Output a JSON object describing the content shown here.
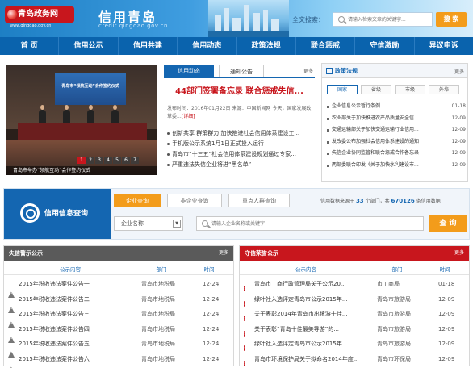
{
  "header": {
    "logo_text": "青岛政务网",
    "logo_sub": "www.qingdao.gov.cn",
    "brand_title": "信用青岛",
    "brand_url": "credit.qingdao.gov.cn",
    "search_label": "全文搜索：",
    "search_placeholder": "请输入检索文章的关键字...",
    "search_button": "搜 索"
  },
  "nav": [
    "首 页",
    "信用公示",
    "信用共建",
    "信用动态",
    "政策法规",
    "联合惩戒",
    "守信激励",
    "异议申诉"
  ],
  "slideshow": {
    "screen_text": "青岛市“领航互动”会作签约仪式",
    "pages": [
      "1",
      "2",
      "3",
      "4",
      "5",
      "6",
      "7"
    ],
    "active_page": "1",
    "caption": "青岛市举办“领航互动”会作签约仪式"
  },
  "news": {
    "tab_active": "信用动态",
    "tab_other": "通知公告",
    "more": "更多",
    "headline": "44部门签署备忘录 联合惩戒失信...",
    "meta": "发布时间：2016年01月22日  来源：中国新闻网  今天，国家发展改革委...",
    "detail_link": "[详细]",
    "items": [
      "创新共享 群策群力 加快推进社会信用体系建设工...",
      "手机版公示系统1月1日正式投入运行",
      "青岛市“十三五”社会信用体系建设规划通过专家...",
      "严重违法失信企业将进“黑名单”"
    ]
  },
  "policy": {
    "title": "政策法规",
    "more": "更多",
    "tabs": [
      "国家",
      "省级",
      "市级",
      "外埠"
    ],
    "active_tab": "国家",
    "items": [
      {
        "text": "企业信息公示暂行条例",
        "date": "01-18"
      },
      {
        "text": "农业部关于加快推进农产品质量安全信...",
        "date": "12-09"
      },
      {
        "text": "交通运输部关于加快交通运输行业信用...",
        "date": "12-09"
      },
      {
        "text": "发改委公布加强社会信用体系建设的通知",
        "date": "12-09"
      },
      {
        "text": "失信企业协同监管和联合惩戒合作备忘录",
        "date": "12-09"
      },
      {
        "text": "两部委联合印发《关于加快水利建设市...",
        "date": "12-09"
      }
    ]
  },
  "query": {
    "title": "信用信息查询",
    "tabs": [
      "企业查询",
      "非企业查询",
      "重点人群查询"
    ],
    "active_tab": "企业查询",
    "stat_prefix": "信用数据来源于",
    "stat_depts": "33",
    "stat_middle": "个部门，共",
    "stat_count": "670126",
    "stat_suffix": "条信用数据",
    "select_value": "企业名称",
    "input_placeholder": "请输入企业名称或关键字",
    "button": "查 询"
  },
  "black": {
    "title": "失信警示公示",
    "more": "更多",
    "cols": [
      "公示内容",
      "部门",
      "时间"
    ],
    "rows": [
      {
        "text": "2015年税收违法案件公告一",
        "dept": "青岛市地税局",
        "date": "12-24"
      },
      {
        "text": "2015年税收违法案件公告二",
        "dept": "青岛市地税局",
        "date": "12-24"
      },
      {
        "text": "2015年税收违法案件公告三",
        "dept": "青岛市地税局",
        "date": "12-24"
      },
      {
        "text": "2015年税收违法案件公告四",
        "dept": "青岛市地税局",
        "date": "12-24"
      },
      {
        "text": "2015年税收违法案件公告五",
        "dept": "青岛市地税局",
        "date": "12-24"
      },
      {
        "text": "2015年税收违法案件公告六",
        "dept": "青岛市地税局",
        "date": "12-24"
      }
    ]
  },
  "red": {
    "title": "守信荣誉公示",
    "more": "更多",
    "cols": [
      "公示内容",
      "部门",
      "时间"
    ],
    "rows": [
      {
        "text": "青岛市工商行政管理局关于公示20...",
        "dept": "市工商局",
        "date": "01-18"
      },
      {
        "text": "绿叶社入选评定青岛市公示2015年...",
        "dept": "青岛市旅游局",
        "date": "12-09"
      },
      {
        "text": "关于表彰2014年青岛市出境游十佳...",
        "dept": "青岛市旅游局",
        "date": "12-09"
      },
      {
        "text": "关于表彰“青岛十佳最美导游”的...",
        "dept": "青岛市旅游局",
        "date": "12-09"
      },
      {
        "text": "绿叶社入选评定青岛市公示2015年...",
        "dept": "青岛市旅游局",
        "date": "12-09"
      },
      {
        "text": "青岛市环境保护局关于拟命名2014年度...",
        "dept": "青岛市环保局",
        "date": "12-09"
      }
    ]
  },
  "colors": {
    "primary": "#1466b1",
    "accent": "#f39c1b",
    "red": "#c8161d",
    "black_head": "#5a5a5a"
  }
}
